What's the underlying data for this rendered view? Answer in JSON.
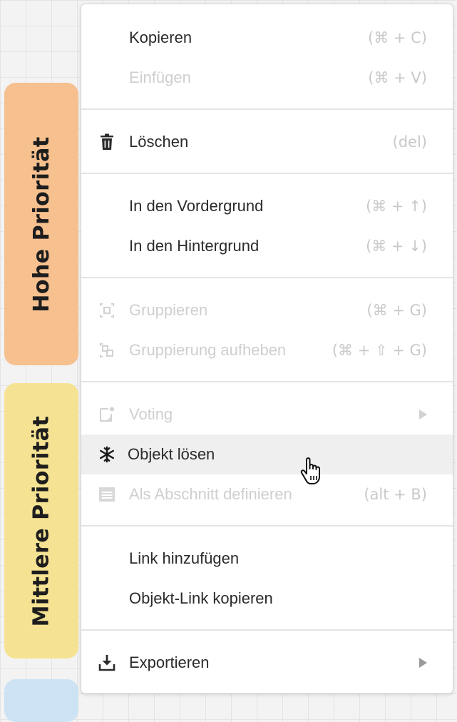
{
  "stickies": {
    "high": "Hohe Priorität",
    "medium": "Mittlere Priorität"
  },
  "menu": {
    "items": [
      {
        "label": "Kopieren",
        "shortcut": "(⌘ + C)",
        "icon": "none",
        "state": "enabled"
      },
      {
        "label": "Einfügen",
        "shortcut": "(⌘ + V)",
        "icon": "none",
        "state": "disabled"
      },
      {
        "label": "Löschen",
        "shortcut": "(del)",
        "icon": "trash-icon",
        "state": "enabled"
      },
      {
        "label": "In den Vordergrund",
        "shortcut": "(⌘ + ↑)",
        "icon": "none",
        "state": "enabled"
      },
      {
        "label": "In den Hintergrund",
        "shortcut": "(⌘ + ↓)",
        "icon": "none",
        "state": "enabled"
      },
      {
        "label": "Gruppieren",
        "shortcut": "(⌘ + G)",
        "icon": "group-icon",
        "state": "disabled"
      },
      {
        "label": "Gruppierung aufheben",
        "shortcut": "(⌘ + ⇧ + G)",
        "icon": "ungroup-icon",
        "state": "disabled"
      },
      {
        "label": "Voting",
        "shortcut": "",
        "icon": "voting-icon",
        "state": "disabled",
        "submenu": true
      },
      {
        "label": "Objekt lösen",
        "shortcut": "",
        "icon": "snowflake-icon",
        "state": "hover"
      },
      {
        "label": "Als Abschnitt definieren",
        "shortcut": "(alt + B)",
        "icon": "section-icon",
        "state": "disabled"
      },
      {
        "label": "Link hinzufügen",
        "shortcut": "",
        "icon": "none",
        "state": "enabled"
      },
      {
        "label": "Objekt-Link kopieren",
        "shortcut": "",
        "icon": "none",
        "state": "enabled"
      },
      {
        "label": "Exportieren",
        "shortcut": "",
        "icon": "download-icon",
        "state": "enabled",
        "submenu": true
      }
    ]
  },
  "colors": {
    "sticky_high": "#f6c08f",
    "sticky_medium": "#f5e393",
    "sticky_low": "#cde3f4",
    "hover_bg": "#efefef",
    "disabled_text": "#cfcfcf"
  }
}
